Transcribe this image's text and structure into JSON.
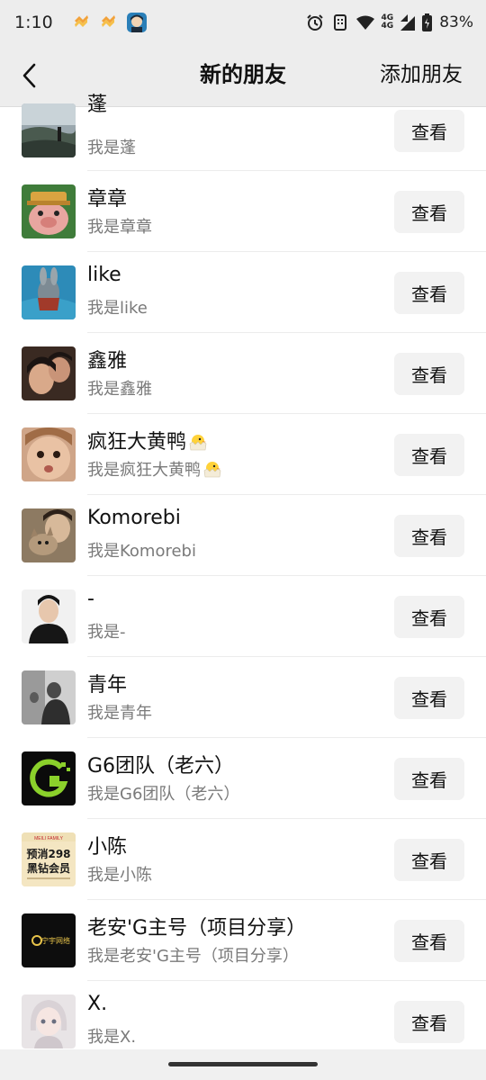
{
  "status": {
    "time": "1:10",
    "battery": "83%",
    "network_top": "4G",
    "network_bottom": "4G"
  },
  "nav": {
    "title": "新的朋友",
    "action": "添加朋友"
  },
  "view_label": "查看",
  "friends": [
    {
      "name": "蓬",
      "message": "我是蓬"
    },
    {
      "name": "章章",
      "message": "我是章章"
    },
    {
      "name": "like",
      "message": "我是like"
    },
    {
      "name": "鑫雅",
      "message": "我是鑫雅"
    },
    {
      "name": "疯狂大黄鸭",
      "message": "我是疯狂大黄鸭"
    },
    {
      "name": "Komorebi",
      "message": "我是Komorebi"
    },
    {
      "name": "-",
      "message": "我是-"
    },
    {
      "name": "青年",
      "message": "我是青年"
    },
    {
      "name": "G6团队（老六）",
      "message": "我是G6团队（老六）"
    },
    {
      "name": "小陈",
      "message": "我是小陈"
    },
    {
      "name": "老安'G主号（项目分享）",
      "message": "我是老安'G主号（项目分享）"
    },
    {
      "name": "X.",
      "message": "我是X."
    }
  ],
  "avatar_texts": {
    "promo_line1": "预消298",
    "promo_line2": "黑钻会员",
    "promo_top": "MEILI FAMILY",
    "brand": "宁宇网络"
  },
  "colors": {
    "bar_bg": "#ededed",
    "button_bg": "#f2f2f2",
    "secondary_text": "#7a7a7a",
    "g6_green": "#8bd12b"
  }
}
